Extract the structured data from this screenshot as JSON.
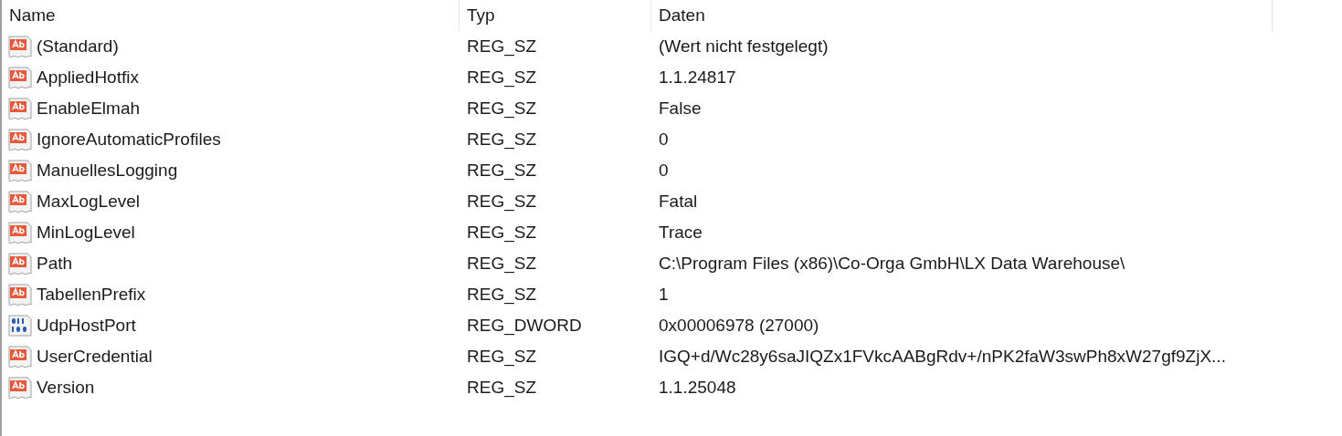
{
  "columns": [
    "Name",
    "Typ",
    "Daten"
  ],
  "rows": [
    {
      "kind": "string",
      "name": "(Standard)",
      "type": "REG_SZ",
      "data": "(Wert nicht festgelegt)"
    },
    {
      "kind": "string",
      "name": "AppliedHotfix",
      "type": "REG_SZ",
      "data": "1.1.24817"
    },
    {
      "kind": "string",
      "name": "EnableElmah",
      "type": "REG_SZ",
      "data": "False"
    },
    {
      "kind": "string",
      "name": "IgnoreAutomaticProfiles",
      "type": "REG_SZ",
      "data": "0"
    },
    {
      "kind": "string",
      "name": "ManuellesLogging",
      "type": "REG_SZ",
      "data": "0"
    },
    {
      "kind": "string",
      "name": "MaxLogLevel",
      "type": "REG_SZ",
      "data": "Fatal"
    },
    {
      "kind": "string",
      "name": "MinLogLevel",
      "type": "REG_SZ",
      "data": "Trace"
    },
    {
      "kind": "string",
      "name": "Path",
      "type": "REG_SZ",
      "data": "C:\\Program Files (x86)\\Co-Orga GmbH\\LX Data Warehouse\\"
    },
    {
      "kind": "string",
      "name": "TabellenPrefix",
      "type": "REG_SZ",
      "data": "1"
    },
    {
      "kind": "binary",
      "name": "UdpHostPort",
      "type": "REG_DWORD",
      "data": "0x00006978 (27000)"
    },
    {
      "kind": "string",
      "name": "UserCredential",
      "type": "REG_SZ",
      "data": "IGQ+d/Wc28y6saJIQZx1FVkcAABgRdv+/nPK2faW3swPh8xW27gf9ZjX..."
    },
    {
      "kind": "string",
      "name": "Version",
      "type": "REG_SZ",
      "data": "1.1.25048"
    }
  ]
}
